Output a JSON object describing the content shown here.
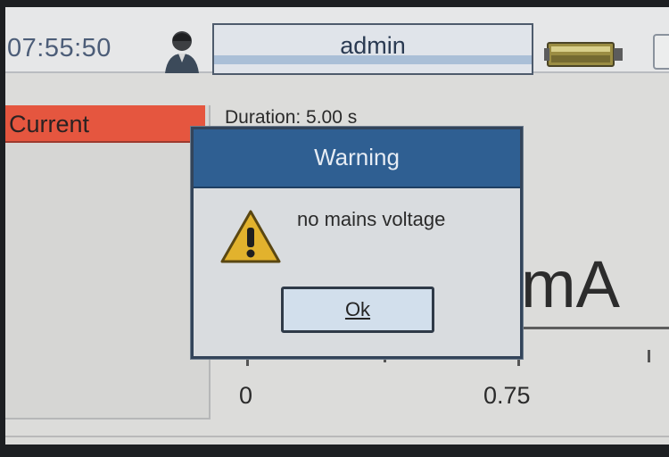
{
  "header": {
    "clock": "07:55:50",
    "username": "admin",
    "icons": {
      "user": "user-avatar-icon",
      "device": "device-status-icon"
    }
  },
  "panel": {
    "current_tab": "Current",
    "duration": "Duration: 5.00 s",
    "unit": "mA",
    "axis_labels": [
      "0",
      "0.75"
    ]
  },
  "dialog": {
    "title": "Warning",
    "message": "no mains voltage",
    "ok_label": "Ok",
    "icon": "warning-icon"
  },
  "colors": {
    "tab_accent": "#e5563f",
    "dialog_header": "#2f5f92"
  }
}
